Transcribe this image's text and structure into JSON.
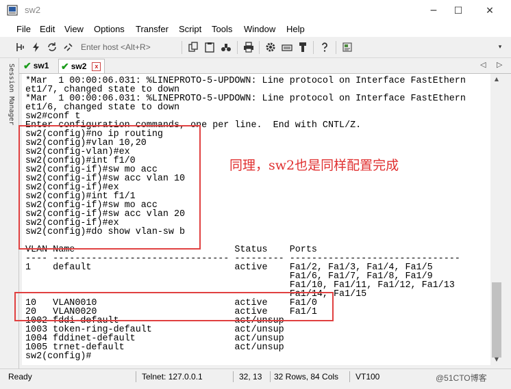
{
  "window": {
    "title": "sw2",
    "minimize_glyph": "─",
    "maximize_glyph": "☐",
    "close_glyph": "✕"
  },
  "menu": [
    "File",
    "Edit",
    "View",
    "Options",
    "Transfer",
    "Script",
    "Tools",
    "Window",
    "Help"
  ],
  "toolbar": {
    "host_placeholder": "Enter host <Alt+R>",
    "icons": [
      "connect-icon",
      "lightning-icon",
      "reconnect-icon",
      "disconnect-icon",
      "copy-icon",
      "paste-icon",
      "find-icon",
      "print-icon",
      "settings-icon",
      "keymap-icon",
      "sftp-icon",
      "help-icon",
      "script-icon"
    ]
  },
  "side_panel": {
    "label": "Session Manager"
  },
  "tabs": [
    {
      "label": "sw1",
      "status": "connected",
      "active": false
    },
    {
      "label": "sw2",
      "status": "connected",
      "active": true,
      "close_glyph": "x"
    }
  ],
  "terminal": {
    "lines": [
      "*Mar  1 00:00:06.031: %LINEPROTO-5-UPDOWN: Line protocol on Interface FastEthern",
      "et1/7, changed state to down",
      "*Mar  1 00:00:06.031: %LINEPROTO-5-UPDOWN: Line protocol on Interface FastEthern",
      "et1/6, changed state to down",
      "sw2#conf t",
      "Enter configuration commands, one per line.  End with CNTL/Z.",
      "sw2(config)#no ip routing",
      "sw2(config)#vlan 10,20",
      "sw2(config-vlan)#ex",
      "sw2(config)#int f1/0",
      "sw2(config-if)#sw mo acc",
      "sw2(config-if)#sw acc vlan 10",
      "sw2(config-if)#ex",
      "sw2(config)#int f1/1",
      "sw2(config-if)#sw mo acc",
      "sw2(config-if)#sw acc vlan 20",
      "sw2(config-if)#ex",
      "sw2(config)#do show vlan-sw b",
      "",
      "VLAN Name                             Status    Ports",
      "---- -------------------------------- --------- -------------------------------",
      "1    default                          active    Fa1/2, Fa1/3, Fa1/4, Fa1/5",
      "                                                Fa1/6, Fa1/7, Fa1/8, Fa1/9",
      "                                                Fa1/10, Fa1/11, Fa1/12, Fa1/13",
      "                                                Fa1/14, Fa1/15",
      "10   VLAN0010                         active    Fa1/0",
      "20   VLAN0020                         active    Fa1/1",
      "1002 fddi-default                     act/unsup",
      "1003 token-ring-default               act/unsup",
      "1004 fddinet-default                  act/unsup",
      "1005 trnet-default                    act/unsup",
      "sw2(config)#"
    ]
  },
  "annotation": {
    "text": "同理，sw2也是同样配置完成",
    "color": "#e03030"
  },
  "status": {
    "state": "Ready",
    "connection": "Telnet: 127.0.0.1",
    "cursor": "32, 13",
    "size": "32 Rows, 84 Cols",
    "emulation": "VT100",
    "watermark": "@51CTO博客"
  },
  "colors": {
    "highlight_box": "#e04040",
    "tab_check": "#1a9b1a"
  }
}
